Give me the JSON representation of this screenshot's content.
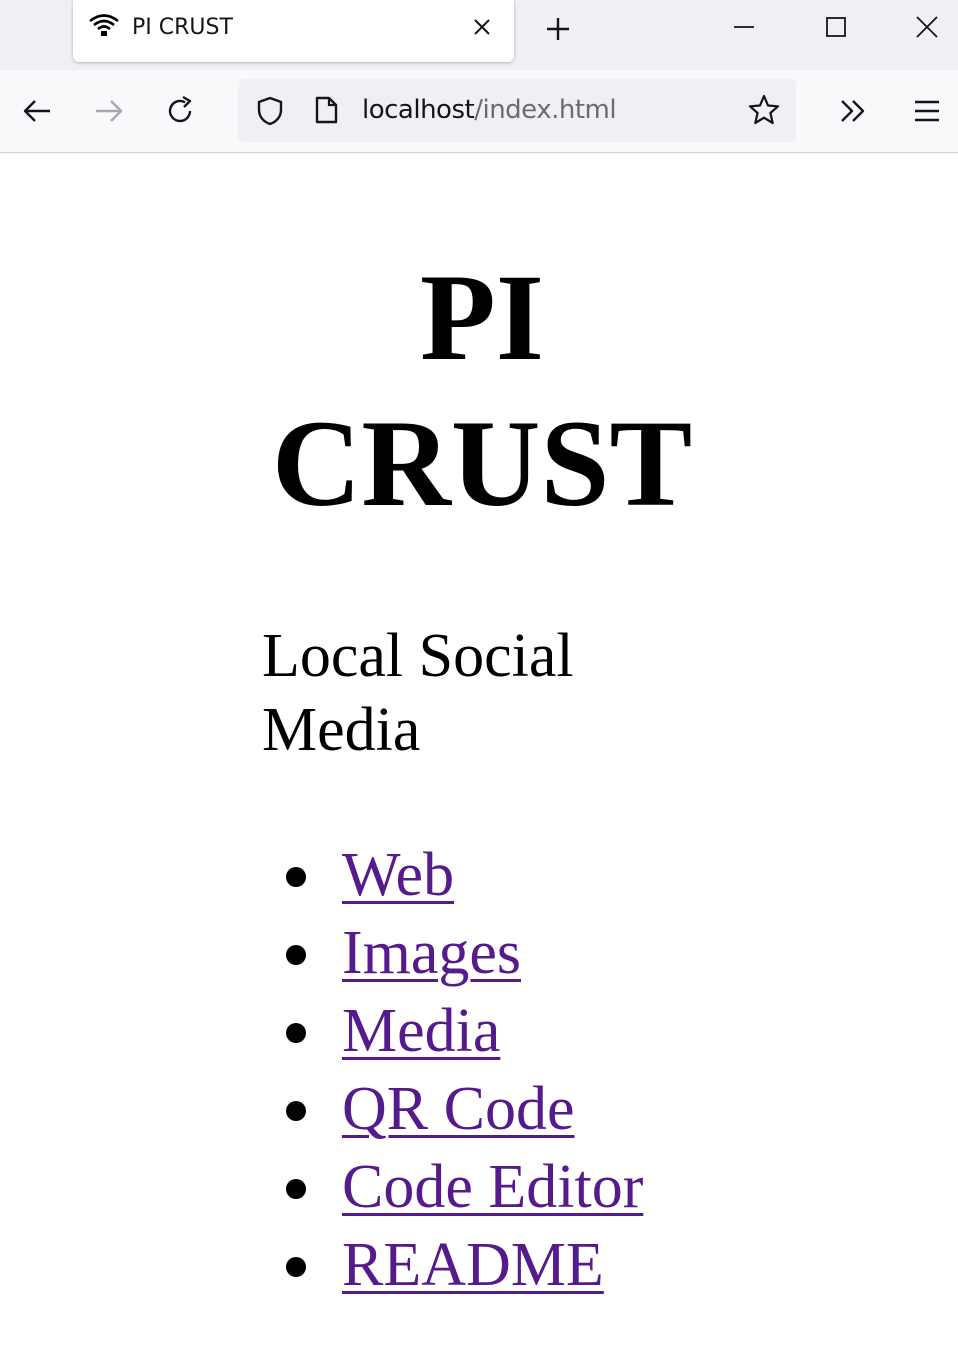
{
  "browser": {
    "tab": {
      "title": "PI CRUST",
      "favicon": "wifi-icon"
    },
    "url": {
      "host": "localhost",
      "path": "/index.html"
    }
  },
  "page": {
    "title": "PI CRUST",
    "subtitle": "Local Social Media",
    "links": [
      {
        "label": "Web"
      },
      {
        "label": "Images"
      },
      {
        "label": "Media"
      },
      {
        "label": "QR Code"
      },
      {
        "label": "Code Editor"
      },
      {
        "label": "README"
      }
    ],
    "colors": {
      "link_visited": "#551a8b",
      "text": "#000000",
      "chrome_bg": "#f0f0f4"
    }
  }
}
